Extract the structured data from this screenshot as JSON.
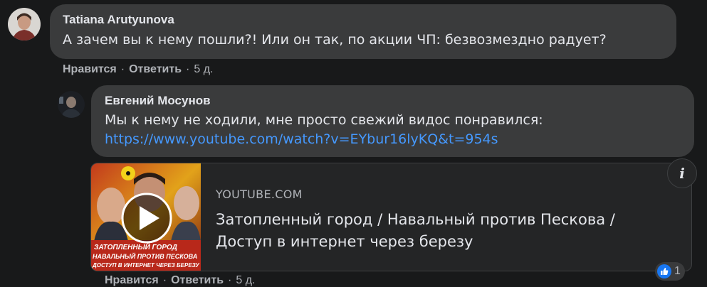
{
  "comments": [
    {
      "author": "Tatiana Arutyunova",
      "text": "А зачем вы к нему пошли?! Или он так, по акции ЧП: безвозмездно радует?",
      "actions": {
        "like": "Нравится",
        "reply": "Ответить",
        "time": "5 д."
      }
    },
    {
      "author": "Евгений Мосунов",
      "text": "Мы к нему не ходили, мне просто свежий видос понравился:",
      "link": "https://www.youtube.com/watch?v=EYbur16lyKQ&t=954s",
      "actions": {
        "like": "Нравится",
        "reply": "Ответить",
        "time": "5 д."
      },
      "preview": {
        "domain": "YOUTUBE.COM",
        "title_line1": "Затопленный город / Навальный против Пескова /",
        "title_line2": "Доступ в интернет через березу",
        "thumb_caption_1": "ЗАТОПЛЕННЫЙ ГОРОД",
        "thumb_caption_2": "НАВАЛЬНЫЙ ПРОТИВ ПЕСКОВА",
        "thumb_caption_3": "ДОСТУП В ИНТЕРНЕТ ЧЕРЕЗ БЕРЕЗУ"
      },
      "reactions": {
        "icon": "like-icon",
        "count": "1"
      }
    }
  ],
  "colors": {
    "background": "#18191a",
    "bubble": "#3a3b3c",
    "link": "#4599ff",
    "secondary_text": "#b0b3b8",
    "like_blue": "#1877f2"
  }
}
